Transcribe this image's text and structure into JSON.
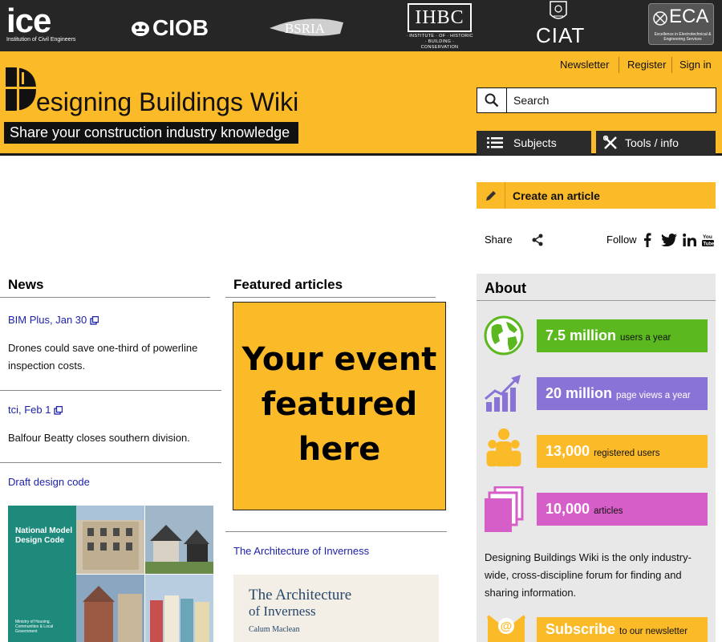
{
  "partners": {
    "ice": {
      "name": "ice",
      "subtitle": "Institution of Civil Engineers"
    },
    "ciob": {
      "name": "CIOB"
    },
    "bsria": {
      "name": "BSRIA"
    },
    "ihbc": {
      "name": "IHBC",
      "subtitle": "· INSTITUTE · OF · HISTORIC · BUILDING · CONSERVATION"
    },
    "ciat": {
      "name": "CIAT"
    },
    "eca": {
      "name": "ECA",
      "subtitle": "Excellence in Electrotechnical & Engineering Services"
    }
  },
  "header": {
    "links": [
      "Newsletter",
      "Register",
      "Sign in"
    ],
    "title_rest": "esigning Buildings Wiki",
    "tagline": "Share your construction industry knowledge",
    "search_placeholder": "Search",
    "menu": {
      "subjects": "Subjects",
      "tools": "Tools / info"
    }
  },
  "actions": {
    "create_article": "Create an article",
    "share": "Share",
    "follow": "Follow"
  },
  "news": {
    "heading": "News",
    "items": [
      {
        "source": "BIM Plus, Jan 30",
        "text": "Drones could save one-third of powerline inspection costs."
      },
      {
        "source": "tci, Feb 1",
        "text": "Balfour Beatty closes southern division."
      },
      {
        "source": "Draft design code",
        "text": ""
      }
    ],
    "image": {
      "title": "National Model Design Code",
      "footer": "Ministry of Housing, Communities & Local Government"
    }
  },
  "featured": {
    "heading": "Featured articles",
    "promo_text": "Your event featured here",
    "article_link": "The Architecture of Inverness",
    "book": {
      "title_line1": "The Architecture",
      "title_line2": "of Inverness",
      "author": "Calum Maclean"
    }
  },
  "about": {
    "heading": "About",
    "stats": [
      {
        "value": "7.5 million",
        "label": "users a year",
        "color": "#5cb81f",
        "icon": "globe-icon"
      },
      {
        "value": "20 million",
        "label": "page views a year",
        "color": "#8a73d6",
        "icon": "growth-chart-icon"
      },
      {
        "value": "13,000",
        "label": "registered users",
        "color": "#fbba28",
        "icon": "users-icon"
      },
      {
        "value": "10,000",
        "label": "articles",
        "color": "#d65ec8",
        "icon": "pages-icon"
      }
    ],
    "description": "Designing Buildings Wiki is the only industry-wide, cross-discipline forum for finding and sharing information.",
    "subscribe": {
      "value": "Subscribe",
      "label": "to our newsletter"
    }
  },
  "colors": {
    "brand_yellow": "#fbba28",
    "dark": "#262626",
    "link": "#1e22aa"
  }
}
